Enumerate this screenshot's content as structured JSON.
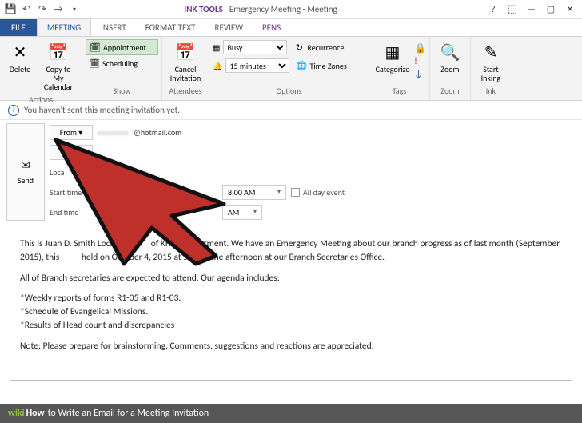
{
  "titlebar": {
    "ink_tools": "INK TOOLS",
    "title": "Emergency Meeting - Meeting"
  },
  "tabs": {
    "file": "FILE",
    "meeting": "MEETING",
    "insert": "INSERT",
    "format_text": "FORMAT TEXT",
    "review": "REVIEW",
    "pens": "PENS"
  },
  "ribbon": {
    "actions": {
      "delete": "Delete",
      "copy_calendar": "Copy to My Calendar",
      "label": "Actions"
    },
    "show": {
      "appointment": "Appointment",
      "scheduling": "Scheduling",
      "label": "Show"
    },
    "attendees": {
      "cancel": "Cancel Invitation",
      "label": "Attendees"
    },
    "options": {
      "busy": "Busy",
      "reminder": "15 minutes",
      "recurrence": "Recurrence",
      "time_zones": "Time Zones",
      "label": "Options"
    },
    "tags": {
      "categorize": "Categorize",
      "label": "Tags"
    },
    "zoom": {
      "zoom": "Zoom",
      "label": "Zoom"
    },
    "ink": {
      "start_inking": "Start Inking",
      "label": "Ink"
    }
  },
  "infobar": {
    "text": "You haven't sent this meeting invitation yet."
  },
  "compose": {
    "send": "Send",
    "from_btn": "From ▾",
    "from_val": "@hotmail.com",
    "location_lbl": "Loca",
    "start_lbl": "Start time",
    "end_lbl": "End time",
    "start_time": "8:00 AM",
    "end_time_partial": "AM",
    "all_day": "All day event"
  },
  "body": {
    "p1": "This is Juan D. Smith Local Se",
    "p1b": "of KHM Department. We have an Emergency Meeting about our branch progress as of last month (September 2015), this",
    "p1c": "held on October 4, 2015 at 5:30 in the afternoon at our Branch Secretaries Office.",
    "p2": "All of Branch secretaries are expected to attend, Our agenda includes:",
    "p3a": "*Weekly reports of forms R1-05 and R1-03.",
    "p3b": "*Schedule of Evangelical Missions.",
    "p3c": "*Results of Head count and discrepancies",
    "p4": "Note: Please prepare for brainstorming. Comments, suggestions and reactions are appreciated."
  },
  "caption": {
    "wiki": "wiki",
    "how": "How",
    "text": " to Write an Email for a Meeting Invitation"
  }
}
